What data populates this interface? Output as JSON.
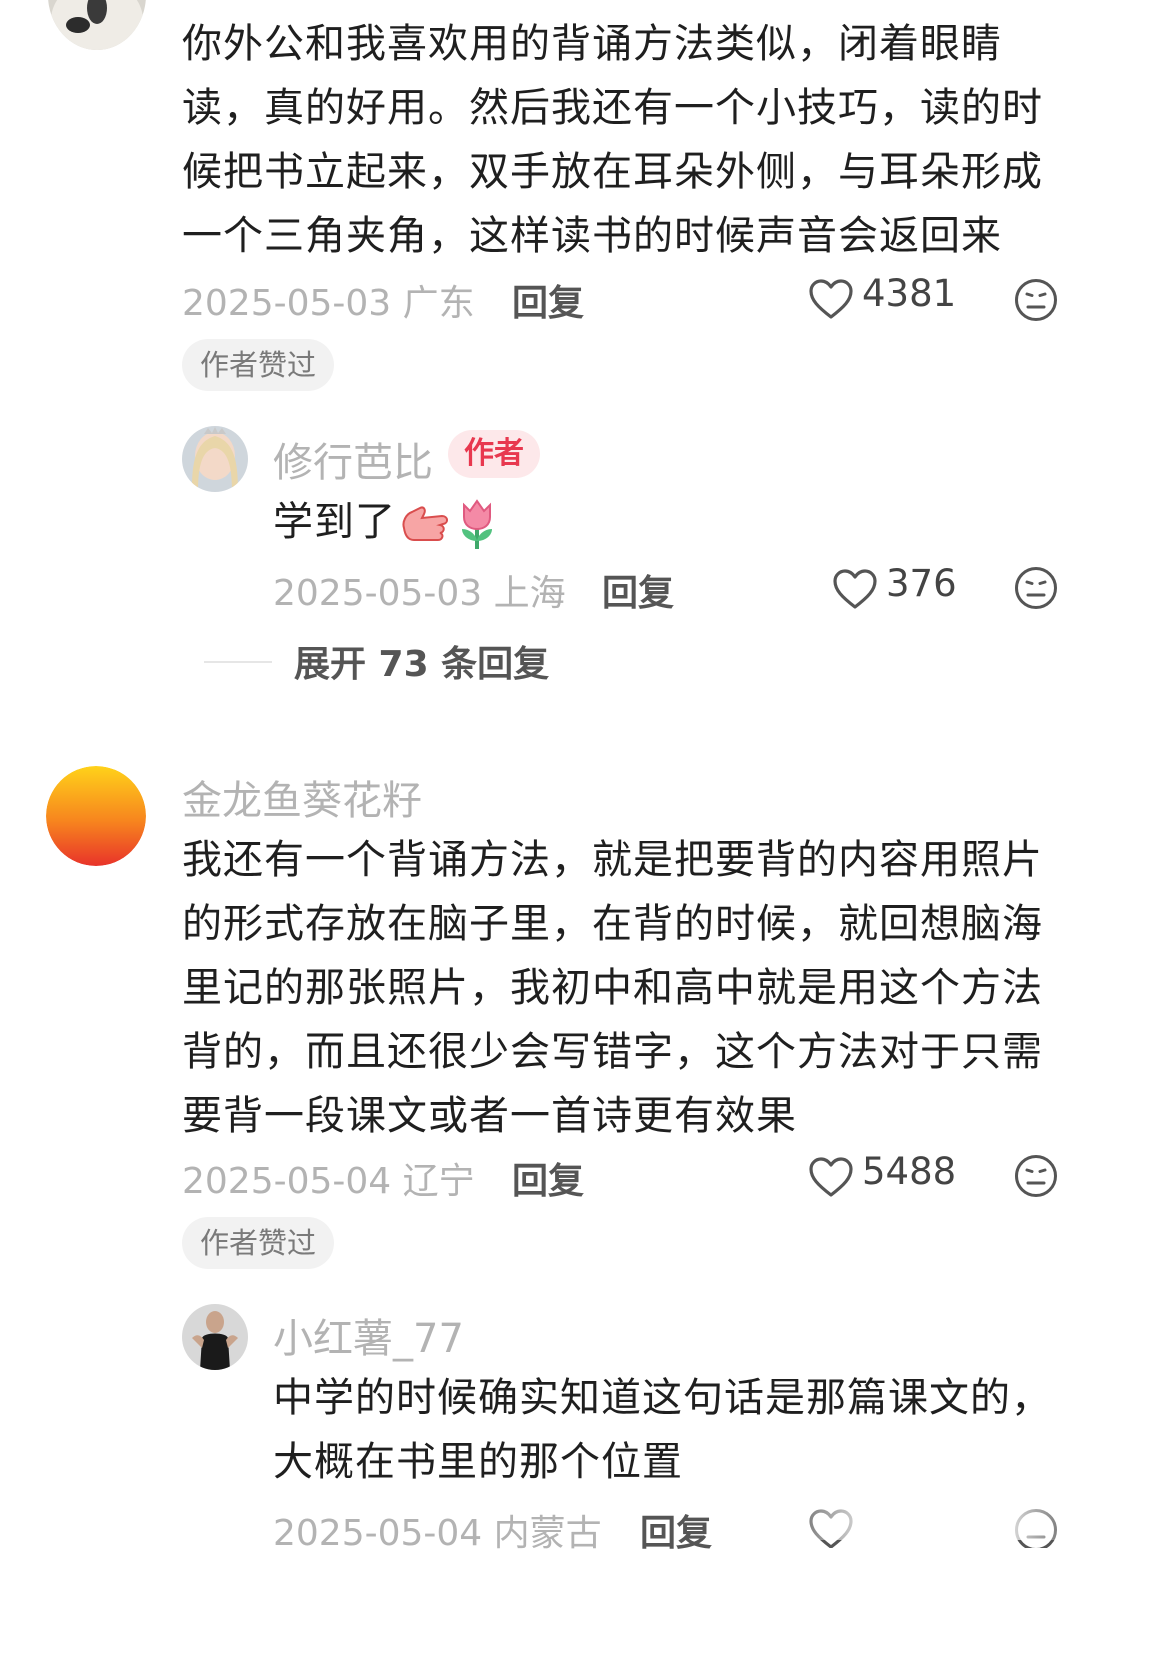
{
  "comments": [
    {
      "text_lines": [
        "你外公和我喜欢用的背诵方法类似，闭着眼睛",
        "读，真的好用。然后我还有一个小技巧，读的时",
        "候把书立起来，双手放在耳朵外侧，与耳朵形成",
        "一个三角夹角，这样读书的时候声音会返回来"
      ],
      "date_location": "2025-05-03 广东",
      "reply_label": "回复",
      "like_count": "4381",
      "liked_by_author": "作者赞过",
      "replies": [
        {
          "username": "修行芭比",
          "author_tag": "作者",
          "text": "学到了",
          "date_location": "2025-05-03 上海",
          "reply_label": "回复",
          "like_count": "376"
        }
      ],
      "expand_label": "展开 73 条回复"
    },
    {
      "username": "金龙鱼葵花籽",
      "text_lines": [
        "我还有一个背诵方法，就是把要背的内容用照片",
        "的形式存放在脑子里，在背的时候，就回想脑海",
        "里记的那张照片，我初中和高中就是用这个方法",
        "背的，而且还很少会写错字，这个方法对于只需",
        "要背一段课文或者一首诗更有效果"
      ],
      "date_location": "2025-05-04 辽宁",
      "reply_label": "回复",
      "like_count": "5488",
      "liked_by_author": "作者赞过",
      "replies": [
        {
          "username": "小红薯_77",
          "text_lines": [
            "中学的时候确实知道这句话是那篇课文的，",
            "大概在书里的那个位置"
          ],
          "date_location": "2025-05-04 内蒙古",
          "reply_label": "回复"
        }
      ]
    }
  ],
  "icons": {
    "heart": "heart-icon",
    "dislike": "meh-face-icon",
    "emoji_hands": "clapping-hands-emoji",
    "emoji_tulip": "tulip-emoji"
  },
  "colors": {
    "author_tag_bg": "#fde8ea",
    "author_tag_text": "#e8384f",
    "meta_gray": "#b3b3b3"
  }
}
